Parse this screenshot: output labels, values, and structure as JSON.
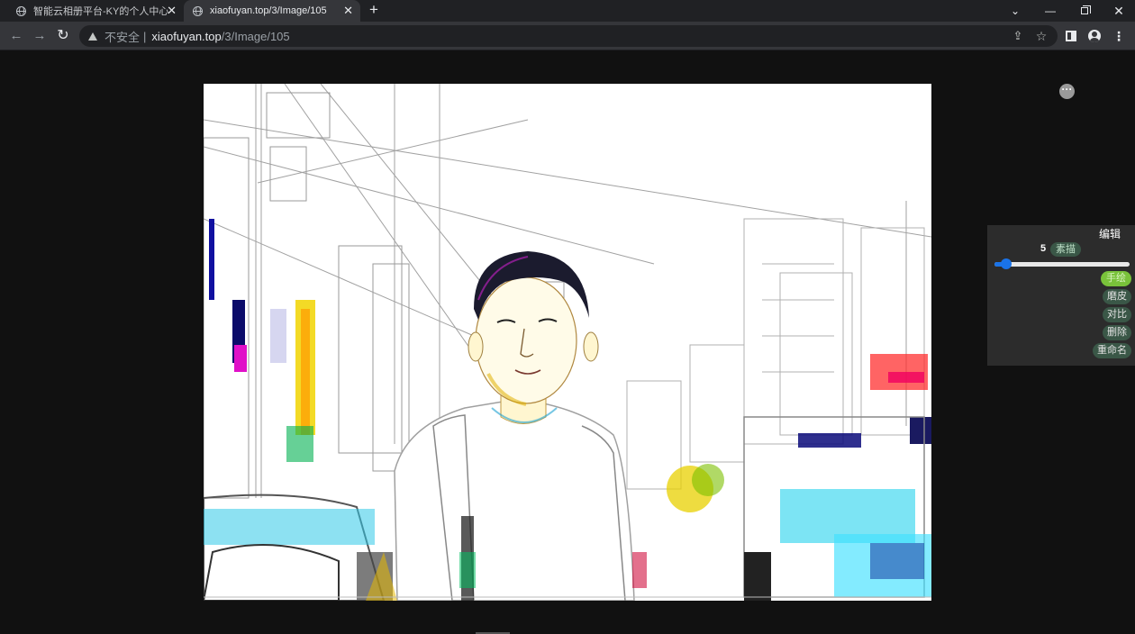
{
  "browser": {
    "tabs": [
      {
        "title": "智能云相册平台-KY的个人中心",
        "active": false
      },
      {
        "title": "xiaofuyan.top/3/Image/105",
        "active": true
      }
    ],
    "new_tab_label": "+",
    "address": {
      "security_label": "不安全",
      "separator": "|",
      "host": "xiaofuyan.top",
      "path": "/3/Image/105"
    }
  },
  "icons": {
    "tab_favicon": "globe-icon",
    "back": "arrow-left-icon",
    "forward": "arrow-right-icon",
    "reload": "reload-icon",
    "security": "warning-triangle-icon",
    "share": "share-icon",
    "bookmark": "star-icon",
    "side_panel": "side-panel-icon",
    "profile": "profile-icon",
    "menu": "kebab-menu-icon",
    "more": "more-icon"
  },
  "viewer": {
    "image_alt": "素描效果照片",
    "more_label": "···"
  },
  "edit_panel": {
    "title": "编辑",
    "level": "5",
    "style": "素描",
    "slider_fraction": 0.05,
    "actions": {
      "draw": "手绘",
      "smooth": "磨皮",
      "compare": "对比",
      "delete": "删除",
      "rename": "重命名"
    }
  },
  "colors": {
    "browser_dark": "#202124",
    "toolbar": "#35363a",
    "page_bg": "#111111",
    "accent_blue": "#1a73e8",
    "active_green": "#79c23a",
    "badge_green": "#3a5747"
  }
}
